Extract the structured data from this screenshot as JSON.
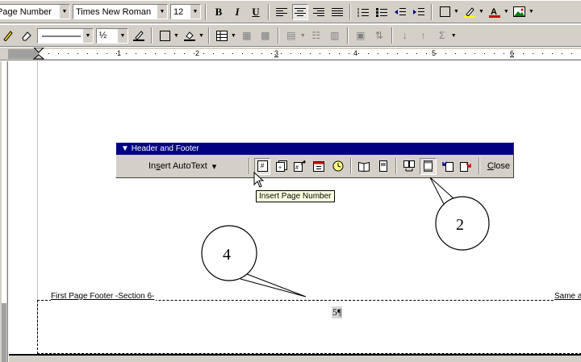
{
  "toolbar1": {
    "style_value": "Page Number",
    "font_value": "Times New Roman",
    "size_value": "12",
    "bold": "B",
    "italic": "I",
    "underline": "U"
  },
  "toolbar2": {
    "line_weight_value": "½"
  },
  "ruler": {
    "numbers": [
      "1",
      "2",
      "3",
      "4",
      "5",
      "6"
    ]
  },
  "document": {
    "footer_label": "First Page Footer -Section 6-",
    "same_label": "Same a",
    "page_number_text": "5¶"
  },
  "hf_toolbar": {
    "title": "Header and Footer",
    "autotext_prefix": "In",
    "autotext_underlined": "s",
    "autotext_suffix": "ert AutoText",
    "autotext_arrow": "▾",
    "close_underlined": "C",
    "close_suffix": "lose"
  },
  "tooltip": {
    "text": "Insert Page Number"
  },
  "callouts": {
    "first": "4",
    "second": "2"
  },
  "icons": {
    "insert_page_number": "page-number-icon",
    "insert_number_of_pages": "number-of-pages-icon",
    "format_page_number": "format-page-number-icon",
    "insert_date": "date-icon",
    "insert_time": "clock-icon",
    "page_setup": "page-setup-icon",
    "show_hide_text": "show-hide-document-text-icon",
    "same_as_previous": "same-as-previous-icon",
    "switch_header_footer": "switch-header-footer-icon",
    "show_previous": "show-previous-icon",
    "show_next": "show-next-icon"
  },
  "colors": {
    "title_bar": "#000080",
    "toolbar_bg": "#d4d0c8",
    "tooltip_bg": "#ffffe1",
    "font_color_swatch": "#cc0000",
    "highlight_swatch": "#ffff00"
  }
}
